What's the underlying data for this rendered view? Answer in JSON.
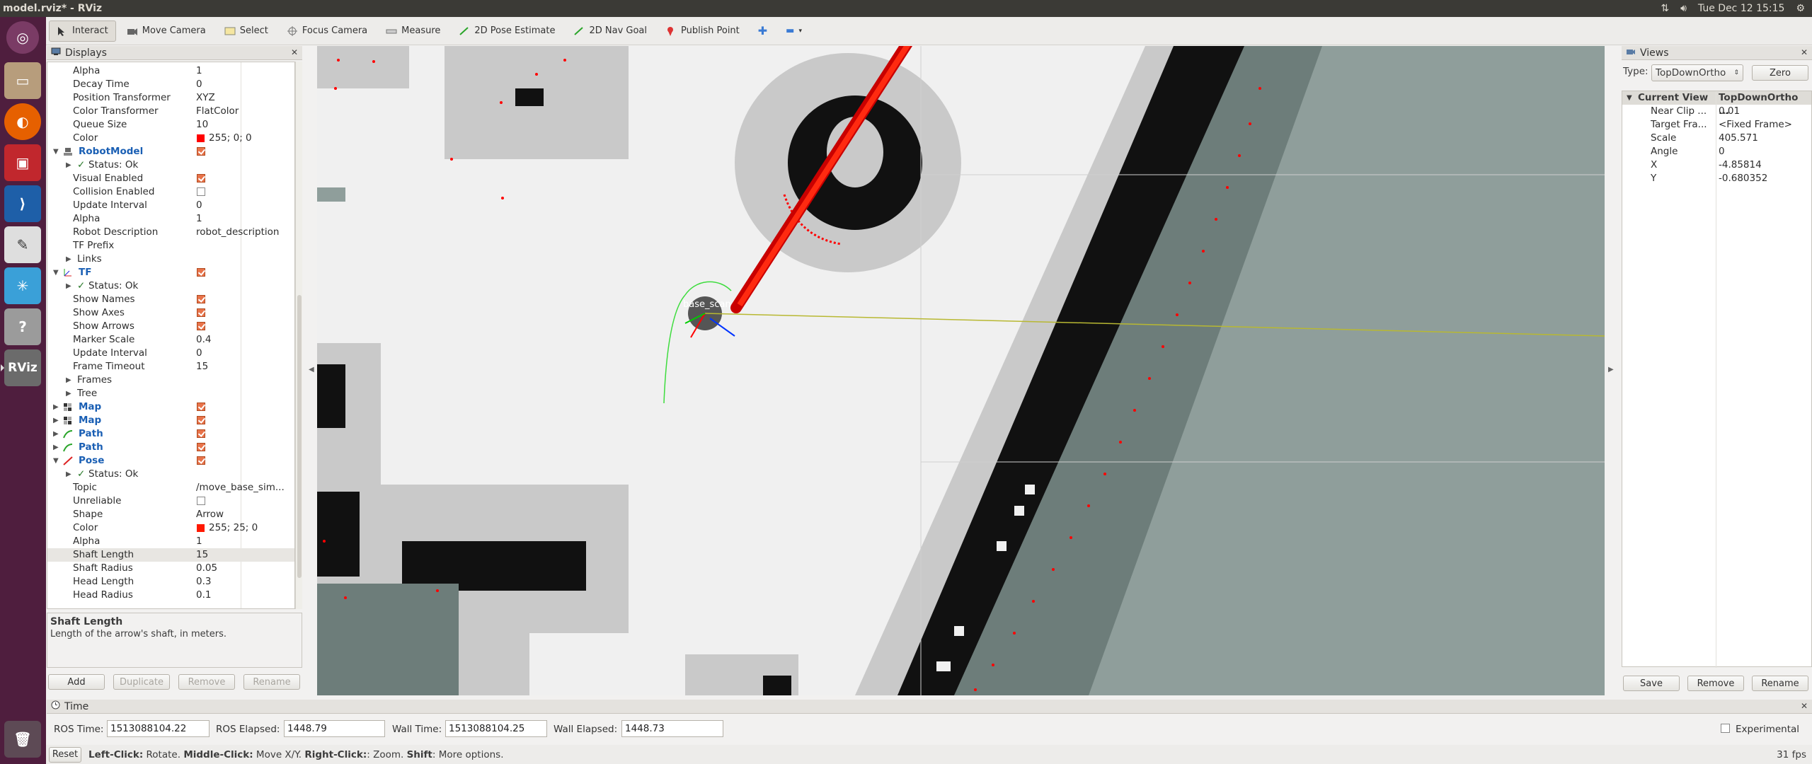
{
  "window": {
    "title": "model.rviz* - RViz"
  },
  "top_panel": {
    "time": "Tue Dec 12 15:15"
  },
  "toolbar": {
    "interact": "Interact",
    "move_camera": "Move Camera",
    "select": "Select",
    "focus_camera": "Focus Camera",
    "measure": "Measure",
    "pose_estimate": "2D Pose Estimate",
    "nav_goal": "2D Nav Goal",
    "publish_point": "Publish Point"
  },
  "displays": {
    "title": "Displays",
    "rows": [
      {
        "label": "Alpha",
        "value": "1"
      },
      {
        "label": "Decay Time",
        "value": "0"
      },
      {
        "label": "Position Transformer",
        "value": "XYZ"
      },
      {
        "label": "Color Transformer",
        "value": "FlatColor"
      },
      {
        "label": "Queue Size",
        "value": "10"
      },
      {
        "label": "Color",
        "value": "255; 0; 0"
      },
      {
        "label": "RobotModel",
        "value": ""
      },
      {
        "label": "Status: Ok",
        "value": ""
      },
      {
        "label": "Visual Enabled",
        "value": ""
      },
      {
        "label": "Collision Enabled",
        "value": ""
      },
      {
        "label": "Update Interval",
        "value": "0"
      },
      {
        "label": "Alpha",
        "value": "1"
      },
      {
        "label": "Robot Description",
        "value": "robot_description"
      },
      {
        "label": "TF Prefix",
        "value": ""
      },
      {
        "label": "Links",
        "value": ""
      },
      {
        "label": "TF",
        "value": ""
      },
      {
        "label": "Status: Ok",
        "value": ""
      },
      {
        "label": "Show Names",
        "value": ""
      },
      {
        "label": "Show Axes",
        "value": ""
      },
      {
        "label": "Show Arrows",
        "value": ""
      },
      {
        "label": "Marker Scale",
        "value": "0.4"
      },
      {
        "label": "Update Interval",
        "value": "0"
      },
      {
        "label": "Frame Timeout",
        "value": "15"
      },
      {
        "label": "Frames",
        "value": ""
      },
      {
        "label": "Tree",
        "value": ""
      },
      {
        "label": "Map",
        "value": ""
      },
      {
        "label": "Map",
        "value": ""
      },
      {
        "label": "Path",
        "value": ""
      },
      {
        "label": "Path",
        "value": ""
      },
      {
        "label": "Pose",
        "value": ""
      },
      {
        "label": "Status: Ok",
        "value": ""
      },
      {
        "label": "Topic",
        "value": "/move_base_sim..."
      },
      {
        "label": "Unreliable",
        "value": ""
      },
      {
        "label": "Shape",
        "value": "Arrow"
      },
      {
        "label": "Color",
        "value": "255; 25; 0"
      },
      {
        "label": "Alpha",
        "value": "1"
      },
      {
        "label": "Shaft Length",
        "value": "15"
      },
      {
        "label": "Shaft Radius",
        "value": "0.05"
      },
      {
        "label": "Head Length",
        "value": "0.3"
      },
      {
        "label": "Head Radius",
        "value": "0.1"
      }
    ],
    "description_title": "Shaft Length",
    "description_text": "Length of the arrow's shaft, in meters.",
    "buttons": {
      "add": "Add",
      "duplicate": "Duplicate",
      "remove": "Remove",
      "rename": "Rename"
    }
  },
  "viewport": {
    "frame_label": "base_scan"
  },
  "views": {
    "title": "Views",
    "type_label": "Type:",
    "type_value": "TopDownOrtho",
    "zero": "Zero",
    "current_view": "Current View",
    "current_view_type": "TopDownOrtho ...",
    "rows": [
      {
        "key": "Near Clip ...",
        "value": "0.01"
      },
      {
        "key": "Target Fra...",
        "value": "<Fixed Frame>"
      },
      {
        "key": "Scale",
        "value": "405.571"
      },
      {
        "key": "Angle",
        "value": "0"
      },
      {
        "key": "X",
        "value": "-4.85814"
      },
      {
        "key": "Y",
        "value": "-0.680352"
      }
    ],
    "buttons": {
      "save": "Save",
      "remove": "Remove",
      "rename": "Rename"
    }
  },
  "time": {
    "title": "Time",
    "ros_time_label": "ROS Time:",
    "ros_time": "1513088104.22",
    "ros_elapsed_label": "ROS Elapsed:",
    "ros_elapsed": "1448.79",
    "wall_time_label": "Wall Time:",
    "wall_time": "1513088104.25",
    "wall_elapsed_label": "Wall Elapsed:",
    "wall_elapsed": "1448.73",
    "experimental": "Experimental"
  },
  "status": {
    "reset": "Reset",
    "left_click": "Left-Click:",
    "left_click_text": " Rotate. ",
    "middle_click": "Middle-Click:",
    "middle_click_text": " Move X/Y. ",
    "right_click": "Right-Click:",
    "right_click_text": ": Zoom. ",
    "shift": "Shift",
    "shift_text": ": More options.",
    "fps": "31 fps"
  },
  "colors": {
    "launcher_bg": "#4f1e3e",
    "check_orange": "#e8734a",
    "category_blue": "#1a5fb4",
    "pose_arrow_red": "#ff1900",
    "scan_red": "#ff0000"
  }
}
